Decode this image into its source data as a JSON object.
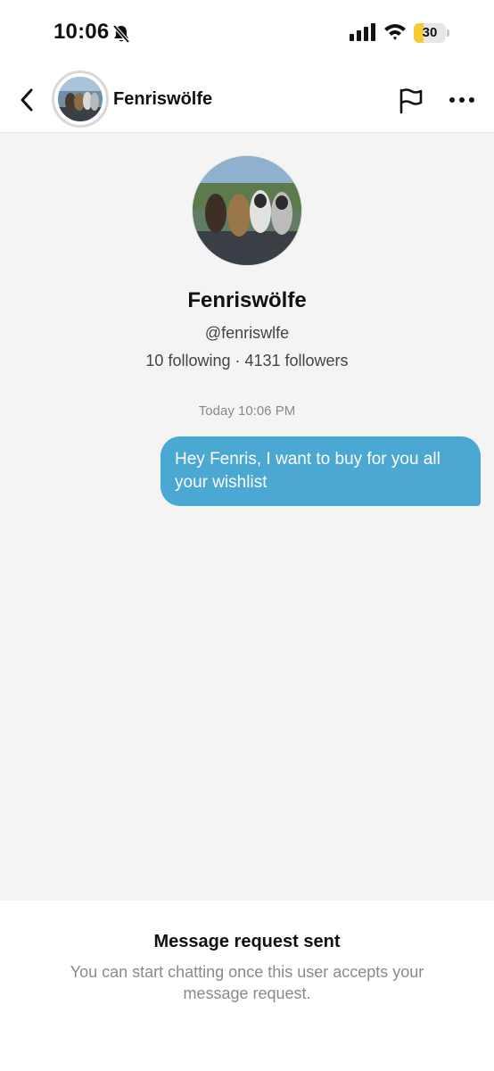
{
  "status_bar": {
    "time": "10:06",
    "battery_level": "30",
    "battery_fraction": 0.3,
    "icons": [
      "bell-muted-icon",
      "signal-icon",
      "wifi-icon",
      "battery-icon"
    ]
  },
  "header": {
    "name": "Fenriswölfe",
    "icons": [
      "back-icon",
      "flag-icon",
      "more-icon"
    ]
  },
  "profile": {
    "name": "Fenriswölfe",
    "handle": "@fenriswlfe",
    "stats": "10 following · 4131 followers"
  },
  "chat": {
    "timestamp": "Today 10:06 PM",
    "messages": [
      {
        "from": "me",
        "text": "Hey Fenris, I want to buy for you all your wishlist"
      }
    ]
  },
  "footer": {
    "title": "Message request sent",
    "description": "You can start chatting once this user accepts your message request."
  },
  "colors": {
    "bubble": "#4aa8d2",
    "battery": "#f5cc34",
    "chat_bg": "#f4f4f4"
  }
}
